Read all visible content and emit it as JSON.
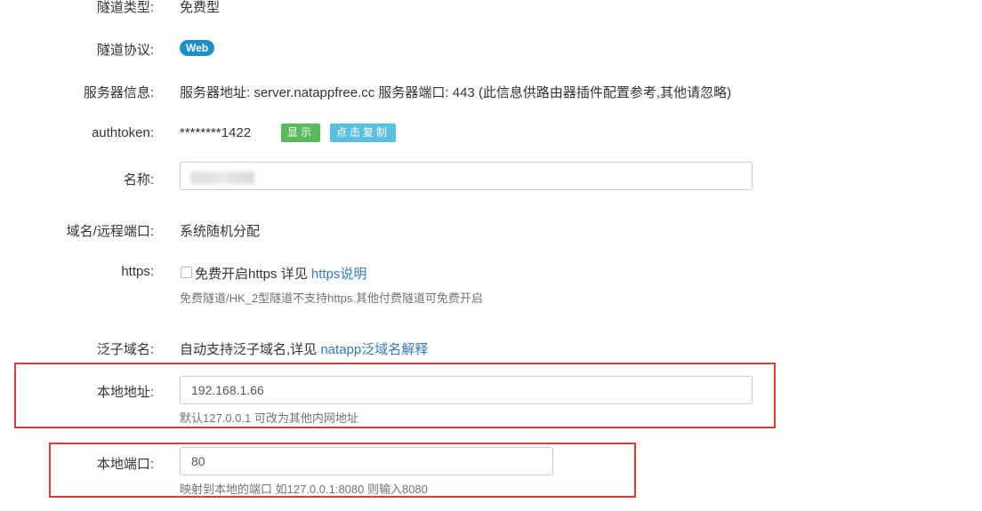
{
  "tunnel_type": {
    "label": "隧道类型:",
    "value": "免费型"
  },
  "tunnel_protocol": {
    "label": "隧道协议:",
    "badge": "Web"
  },
  "server_info": {
    "label": "服务器信息:",
    "value": "服务器地址: server.natappfree.cc 服务器端口: 443 (此信息供路由器插件配置参考,其他请忽略)"
  },
  "authtoken": {
    "label": "authtoken:",
    "value": "********1422",
    "show_button": "显示",
    "copy_button": "点击复制"
  },
  "name": {
    "label": "名称:",
    "value": ""
  },
  "domain_port": {
    "label": "域名/远程端口:",
    "value": "系统随机分配"
  },
  "https": {
    "label": "https:",
    "checkbox_text": "免费开启https 详见 ",
    "link": "https说明",
    "help": "免费隧道/HK_2型隧道不支持https.其他付费隧道可免费开启"
  },
  "wildcard": {
    "label": "泛子域名:",
    "text": "自动支持泛子域名,详见 ",
    "link": "natapp泛域名解释"
  },
  "local_address": {
    "label": "本地地址:",
    "value": "192.168.1.66",
    "help": "默认127.0.0.1 可改为其他内网地址"
  },
  "local_port": {
    "label": "本地端口:",
    "value": "80",
    "help": "映射到本地的端口 如127.0.0.1:8080 则输入8080"
  },
  "colors": {
    "web_badge": "#1e90c8",
    "show_button": "#5cb85c",
    "copy_button": "#5bc0de",
    "link": "#337ab7",
    "highlight_box": "#e53935"
  }
}
